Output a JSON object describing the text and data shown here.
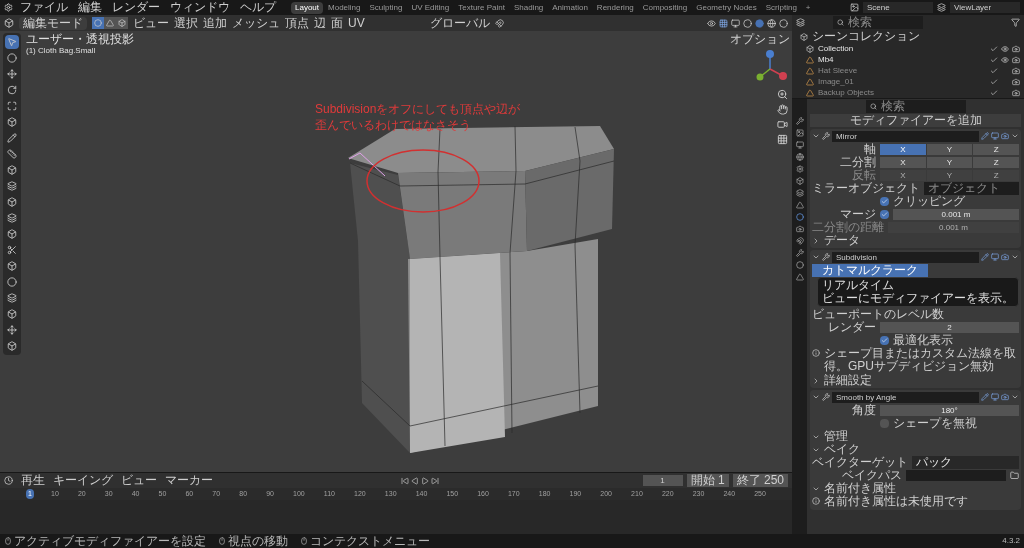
{
  "menu": [
    "ファイル",
    "編集",
    "レンダー",
    "ウィンドウ",
    "ヘルプ"
  ],
  "workspaces": [
    {
      "label": "Layout",
      "selected": true
    },
    {
      "label": "Modeling",
      "selected": false
    },
    {
      "label": "Sculpting",
      "selected": false
    },
    {
      "label": "UV Editing",
      "selected": false
    },
    {
      "label": "Texture Paint",
      "selected": false
    },
    {
      "label": "Shading",
      "selected": false
    },
    {
      "label": "Animation",
      "selected": false
    },
    {
      "label": "Rendering",
      "selected": false
    },
    {
      "label": "Compositing",
      "selected": false
    },
    {
      "label": "Geometry Nodes",
      "selected": false
    },
    {
      "label": "Scripting",
      "selected": false
    },
    {
      "label": "+",
      "selected": false
    }
  ],
  "scene": "Scene",
  "view_layer": "ViewLayer",
  "viewport": {
    "mode": "編集モード",
    "select_modes": [
      {
        "kind": "vertex",
        "selected": true
      },
      {
        "kind": "edge",
        "selected": false
      },
      {
        "kind": "face",
        "selected": false
      }
    ],
    "menus": [
      "ビュー",
      "選択",
      "追加",
      "メッシュ",
      "頂点",
      "辺",
      "面",
      "UV"
    ],
    "orientation": "グローバル",
    "options": "オプション",
    "view_name": "ユーザー・透視投影",
    "object_name": "(1) Cloth Bag.Small",
    "annotation": [
      "Subdivisionをオフにしても頂点や辺が",
      "歪んでいるわけではなさそう"
    ]
  },
  "outliner": {
    "search_placeholder": "検索",
    "root": "シーンコレクション",
    "items": [
      {
        "name": "Collection",
        "hidden": false,
        "kind": "collection"
      },
      {
        "name": "Mb4",
        "hidden": false,
        "kind": "object"
      },
      {
        "name": "Hat Sleeve",
        "hidden": true,
        "kind": "object"
      },
      {
        "name": "Image_01",
        "hidden": true,
        "kind": "object"
      },
      {
        "name": "Backup Objects",
        "hidden": true,
        "kind": "object"
      }
    ]
  },
  "properties": {
    "search_placeholder": "検索",
    "add_modifier": "モディファイアーを追加",
    "modifiers": [
      {
        "name": "Mirror",
        "rows": [
          {
            "kind": "toggles",
            "label": "軸",
            "disabled": false,
            "options": [
              {
                "label": "X",
                "selected": true
              },
              {
                "label": "Y",
                "selected": false
              },
              {
                "label": "Z",
                "selected": false
              }
            ]
          },
          {
            "kind": "toggles",
            "label": "二分割",
            "disabled": false,
            "options": [
              {
                "label": "X",
                "selected": false
              },
              {
                "label": "Y",
                "selected": false
              },
              {
                "label": "Z",
                "selected": false
              }
            ]
          },
          {
            "kind": "toggles",
            "label": "反転",
            "disabled": true,
            "options": [
              {
                "label": "X",
                "selected": false
              },
              {
                "label": "Y",
                "selected": false
              },
              {
                "label": "Z",
                "selected": false
              }
            ]
          },
          {
            "kind": "object",
            "label": "ミラーオブジェクト",
            "placeholder": "オブジェクト"
          },
          {
            "kind": "checkbox",
            "text": "クリッピング",
            "checked": true
          },
          {
            "kind": "check_value",
            "label": "マージ",
            "checked": true,
            "value": "0.001 m"
          },
          {
            "kind": "value",
            "label": "二分割の距離",
            "value": "0.001 m",
            "disabled": true
          },
          {
            "kind": "subpanel",
            "label": "データ",
            "expanded": false
          }
        ]
      },
      {
        "name": "Subdivision",
        "rows": [
          {
            "kind": "method",
            "options": [
              {
                "label": "カトマルクラーク",
                "selected": true
              }
            ],
            "tooltip": [
              "リアルタイム",
              "ビューにモディファイアーを表示。"
            ]
          },
          {
            "kind": "label",
            "label": "ビューポートのレベル数"
          },
          {
            "kind": "value",
            "label": "レンダー",
            "value": "2",
            "disabled": false
          },
          {
            "kind": "checkbox",
            "text": "最適化表示",
            "checked": true
          },
          {
            "kind": "info",
            "text": "シェープ目またはカスタム法線を取得。GPUサブディビジョン無効"
          },
          {
            "kind": "subpanel",
            "label": "詳細設定",
            "expanded": false
          }
        ]
      },
      {
        "name": "Smooth by Angle",
        "rows": [
          {
            "kind": "value",
            "label": "角度",
            "value": "180°",
            "disabled": false
          },
          {
            "kind": "checkbox",
            "text": "シェープを無視",
            "checked": false
          },
          {
            "kind": "subpanel",
            "label": "管理",
            "expanded": true
          },
          {
            "kind": "subpanel",
            "label": "ベイク",
            "expanded": true
          },
          {
            "kind": "dropdown",
            "label": "ベイクターゲット",
            "value": "パック"
          },
          {
            "kind": "file",
            "label": "ベイクパス"
          },
          {
            "kind": "subpanel",
            "label": "名前付き属性",
            "expanded": true
          },
          {
            "kind": "info",
            "text": "名前付き属性は未使用です"
          }
        ]
      }
    ]
  },
  "timeline": {
    "menus": [
      "再生",
      "キーイング",
      "ビュー",
      "マーカー"
    ],
    "current_frame": "1",
    "start_label": "開始",
    "start": "1",
    "end_label": "終了",
    "end": "250",
    "ruler": [
      {
        "label": "1",
        "selected": true
      },
      {
        "label": "10",
        "selected": false
      },
      {
        "label": "20",
        "selected": false
      },
      {
        "label": "30",
        "selected": false
      },
      {
        "label": "40",
        "selected": false
      },
      {
        "label": "50",
        "selected": false
      },
      {
        "label": "60",
        "selected": false
      },
      {
        "label": "70",
        "selected": false
      },
      {
        "label": "80",
        "selected": false
      },
      {
        "label": "90",
        "selected": false
      },
      {
        "label": "100",
        "selected": false
      },
      {
        "label": "110",
        "selected": false
      },
      {
        "label": "120",
        "selected": false
      },
      {
        "label": "130",
        "selected": false
      },
      {
        "label": "140",
        "selected": false
      },
      {
        "label": "150",
        "selected": false
      },
      {
        "label": "160",
        "selected": false
      },
      {
        "label": "170",
        "selected": false
      },
      {
        "label": "180",
        "selected": false
      },
      {
        "label": "190",
        "selected": false
      },
      {
        "label": "200",
        "selected": false
      },
      {
        "label": "210",
        "selected": false
      },
      {
        "label": "220",
        "selected": false
      },
      {
        "label": "230",
        "selected": false
      },
      {
        "label": "240",
        "selected": false
      },
      {
        "label": "250",
        "selected": false
      }
    ]
  },
  "status": {
    "items": [
      "アクティブモディファイアーを設定",
      "視点の移動",
      "コンテクストメニュー"
    ],
    "version": "4.3.2"
  }
}
